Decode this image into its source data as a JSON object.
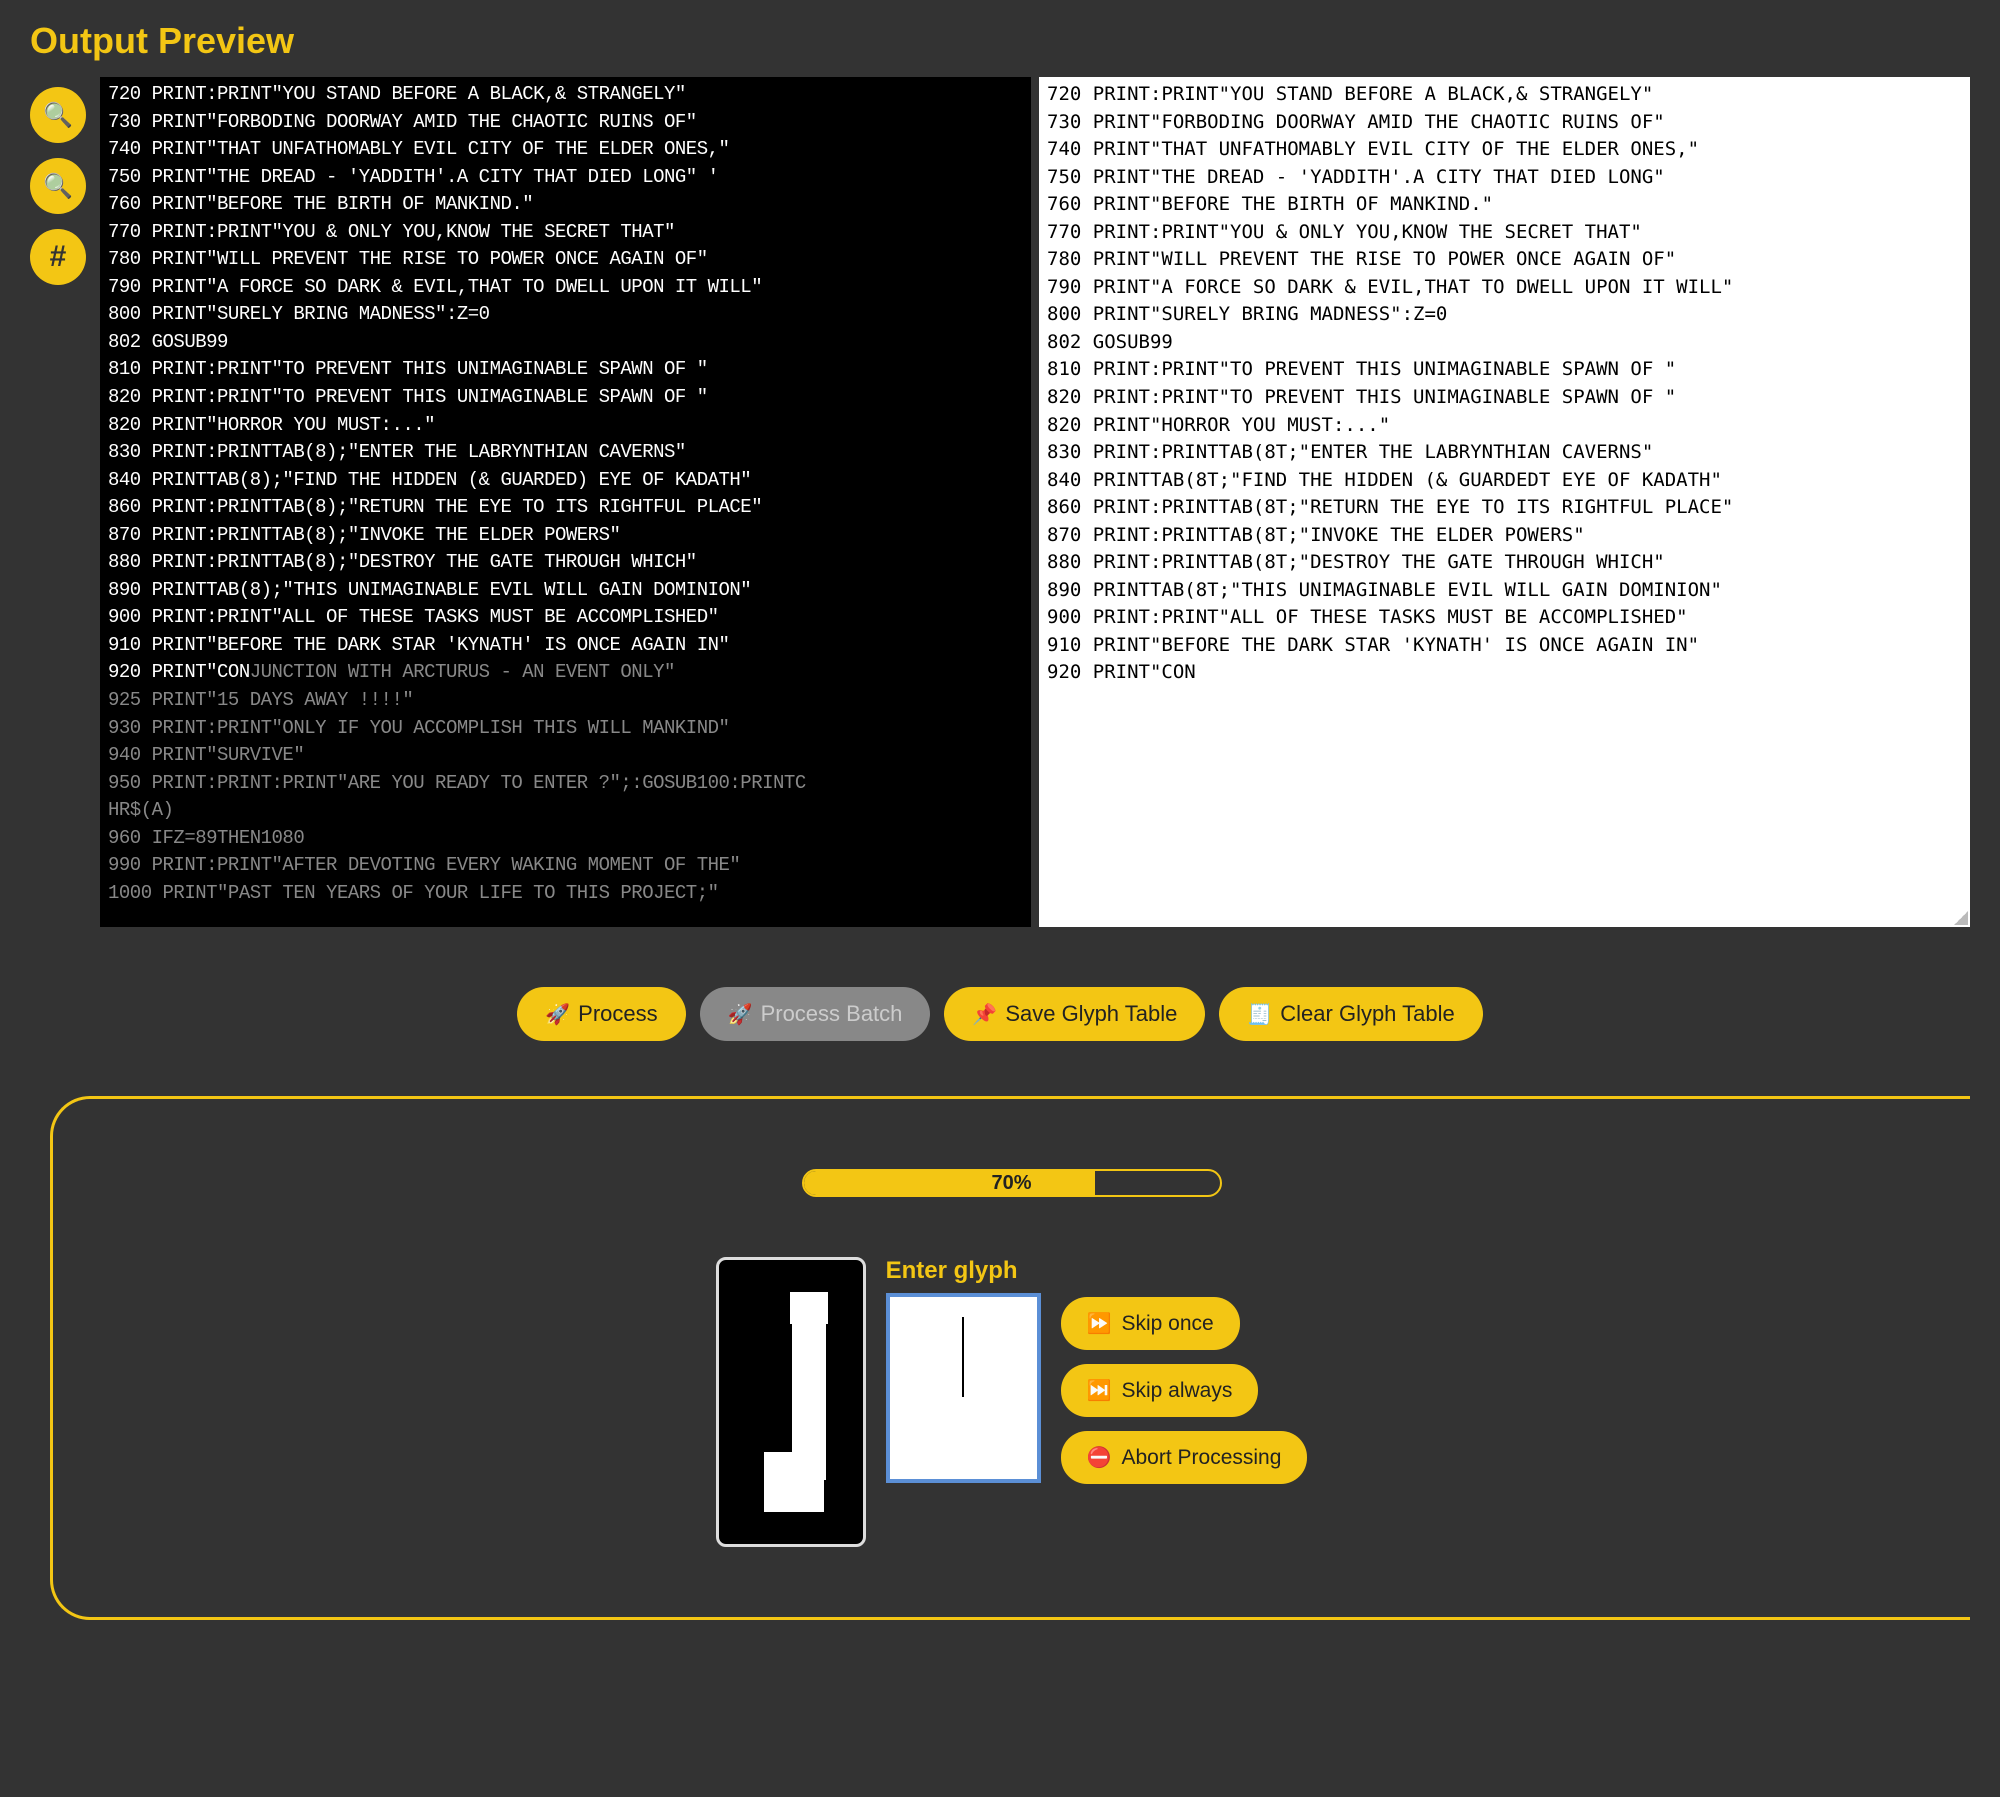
{
  "title": "Output Preview",
  "side_icons": {
    "zoom_in": "🔍",
    "zoom_out": "🔍",
    "hash": "#"
  },
  "left_pane_lines": [
    "720 PRINT:PRINT\"YOU STAND BEFORE A BLACK,& STRANGELY\"",
    "730 PRINT\"FORBODING DOORWAY AMID THE CHAOTIC RUINS OF\"",
    "740 PRINT\"THAT UNFATHOMABLY EVIL CITY OF THE ELDER ONES,\"",
    "750 PRINT\"THE DREAD - 'YADDITH'.A CITY THAT DIED LONG\" '",
    "760 PRINT\"BEFORE THE BIRTH OF MANKIND.\"",
    "770 PRINT:PRINT\"YOU & ONLY YOU,KNOW THE SECRET THAT\"",
    "780 PRINT\"WILL PREVENT THE RISE TO POWER ONCE AGAIN OF\"",
    "790 PRINT\"A FORCE SO DARK & EVIL,THAT TO DWELL UPON IT WILL\"",
    "800 PRINT\"SURELY BRING MADNESS\":Z=0",
    "802 GOSUB99",
    "810 PRINT:PRINT\"TO PREVENT THIS UNIMAGINABLE SPAWN OF \"",
    "820 PRINT:PRINT\"TO PREVENT THIS UNIMAGINABLE SPAWN OF \"",
    "820 PRINT\"HORROR YOU MUST:...\"",
    "830 PRINT:PRINTTAB(8);\"ENTER THE LABRYNTHIAN CAVERNS\"",
    "840 PRINTTAB(8);\"FIND THE HIDDEN (& GUARDED) EYE OF KADATH\"",
    "860 PRINT:PRINTTAB(8);\"RETURN THE EYE TO ITS RIGHTFUL PLACE\"",
    "870 PRINT:PRINTTAB(8);\"INVOKE THE ELDER POWERS\"",
    "880 PRINT:PRINTTAB(8);\"DESTROY THE GATE THROUGH WHICH\"",
    "890 PRINTTAB(8);\"THIS UNIMAGINABLE EVIL WILL GAIN DOMINION\"",
    "900 PRINT:PRINT\"ALL OF THESE TASKS MUST BE ACCOMPLISHED\"",
    "910 PRINT\"BEFORE THE DARK STAR 'KYNATH' IS ONCE AGAIN IN\"",
    "920 PRINT\"CON"
  ],
  "left_pane_fade": [
    "JUNCTION WITH ARCTURUS - AN EVENT ONLY\"",
    "925 PRINT\"15 DAYS AWAY !!!!\"",
    "930 PRINT:PRINT\"ONLY IF YOU ACCOMPLISH THIS WILL MANKIND\"",
    "940 PRINT\"SURVIVE\"",
    "950 PRINT:PRINT:PRINT\"ARE YOU READY TO ENTER ?\";:GOSUB100:PRINTC",
    "HR$(A)",
    "960 IFZ=89THEN1080",
    "990 PRINT:PRINT\"AFTER DEVOTING EVERY WAKING MOMENT OF THE\"",
    "1000 PRINT\"PAST TEN YEARS OF YOUR LIFE TO THIS PROJECT;\""
  ],
  "right_pane_lines": [
    "720 PRINT:PRINT\"YOU STAND BEFORE A BLACK,& STRANGELY\"",
    "730 PRINT\"FORBODING DOORWAY AMID THE CHAOTIC RUINS OF\"",
    "740 PRINT\"THAT UNFATHOMABLY EVIL CITY OF THE ELDER ONES,\"",
    "750 PRINT\"THE DREAD - 'YADDITH'.A CITY THAT DIED LONG\"",
    "760 PRINT\"BEFORE THE BIRTH OF MANKIND.\"",
    "770 PRINT:PRINT\"YOU & ONLY YOU,KNOW THE SECRET THAT\"",
    "780 PRINT\"WILL PREVENT THE RISE TO POWER ONCE AGAIN OF\"",
    "790 PRINT\"A FORCE SO DARK & EVIL,THAT TO DWELL UPON IT WILL\"",
    "800 PRINT\"SURELY BRING MADNESS\":Z=0",
    "802 GOSUB99",
    "810 PRINT:PRINT\"TO PREVENT THIS UNIMAGINABLE SPAWN OF \"",
    "820 PRINT:PRINT\"TO PREVENT THIS UNIMAGINABLE SPAWN OF \"",
    "820 PRINT\"HORROR YOU MUST:...\"",
    "830 PRINT:PRINTTAB(8T;\"ENTER THE LABRYNTHIAN CAVERNS\"",
    "840 PRINTTAB(8T;\"FIND THE HIDDEN (& GUARDEDT EYE OF KADATH\"",
    "860 PRINT:PRINTTAB(8T;\"RETURN THE EYE TO ITS RIGHTFUL PLACE\"",
    "870 PRINT:PRINTTAB(8T;\"INVOKE THE ELDER POWERS\"",
    "880 PRINT:PRINTTAB(8T;\"DESTROY THE GATE THROUGH WHICH\"",
    "890 PRINTTAB(8T;\"THIS UNIMAGINABLE EVIL WILL GAIN DOMINION\"",
    "900 PRINT:PRINT\"ALL OF THESE TASKS MUST BE ACCOMPLISHED\"",
    "910 PRINT\"BEFORE THE DARK STAR 'KYNATH' IS ONCE AGAIN IN\"",
    "920 PRINT\"CON"
  ],
  "buttons": {
    "process": "Process",
    "process_icon": "🚀",
    "process_batch": "Process Batch",
    "process_batch_icon": "🚀",
    "save_glyph": "Save Glyph Table",
    "save_glyph_icon": "📌",
    "clear_glyph": "Clear Glyph Table",
    "clear_glyph_icon": "🧾"
  },
  "progress": {
    "percent": 70,
    "label": "70%"
  },
  "glyph_prompt": {
    "label": "Enter glyph",
    "value": "",
    "skip_once": "Skip once",
    "skip_once_icon": "⏩",
    "skip_always": "Skip always",
    "skip_always_icon": "⏭️",
    "abort": "Abort Processing",
    "abort_icon": "⛔"
  }
}
